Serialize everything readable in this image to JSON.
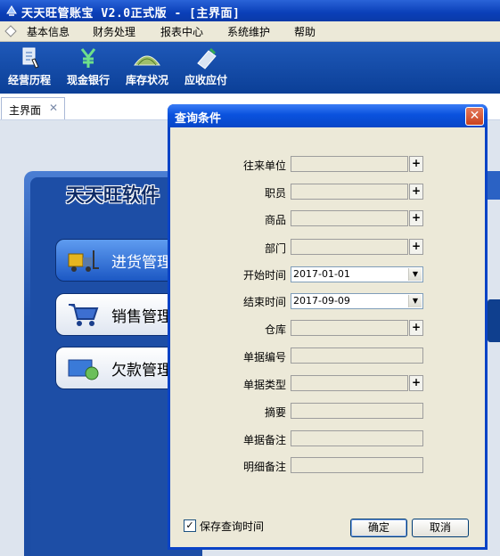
{
  "window": {
    "title": "天天旺管账宝 V2.0正式版 - [主界面]"
  },
  "menubar": {
    "items": [
      "基本信息",
      "财务处理",
      "报表中心",
      "系统维护",
      "帮助"
    ]
  },
  "toolbar": {
    "items": [
      {
        "label": "经营历程",
        "icon": "hand-document-icon"
      },
      {
        "label": "现金银行",
        "icon": "yen-icon"
      },
      {
        "label": "库存状况",
        "icon": "warehouse-icon"
      },
      {
        "label": "应收应付",
        "icon": "invoice-pen-icon"
      }
    ]
  },
  "tabs": [
    {
      "label": "主界面",
      "close": "✕"
    }
  ],
  "panel": {
    "title": "天天旺软件",
    "modules": [
      {
        "label": "进货管理",
        "icon": "forklift-icon"
      },
      {
        "label": "销售管理",
        "icon": "cart-icon"
      },
      {
        "label": "欠款管理",
        "icon": "money-icon"
      }
    ]
  },
  "dialog": {
    "title": "查询条件",
    "close": "✕",
    "fields": [
      {
        "label": "往来单位",
        "type": "lookup",
        "value": ""
      },
      {
        "label": "职员",
        "type": "lookup",
        "value": ""
      },
      {
        "label": "商品",
        "type": "lookup",
        "value": ""
      },
      {
        "label": "部门",
        "type": "lookup",
        "value": ""
      },
      {
        "label": "开始时间",
        "type": "date",
        "value": "2017-01-01"
      },
      {
        "label": "结束时间",
        "type": "date",
        "value": "2017-09-09"
      },
      {
        "label": "仓库",
        "type": "lookup",
        "value": ""
      },
      {
        "label": "单据编号",
        "type": "text",
        "value": ""
      },
      {
        "label": "单据类型",
        "type": "lookup",
        "value": ""
      },
      {
        "label": "摘要",
        "type": "text",
        "value": ""
      },
      {
        "label": "单据备注",
        "type": "text",
        "value": ""
      },
      {
        "label": "明细备注",
        "type": "text",
        "value": ""
      }
    ],
    "lookup_button": "+",
    "save_checkbox": {
      "label": "保存查询时间",
      "checked": true,
      "mark": "✓"
    },
    "ok_label": "确定",
    "cancel_label": "取消"
  },
  "colors": {
    "titlebar": "#0a3fb8",
    "toolbar": "#1f59b9",
    "dialog_frame": "#0a43c6",
    "dialog_body": "#ece9d8",
    "close_button": "#c9421e"
  }
}
